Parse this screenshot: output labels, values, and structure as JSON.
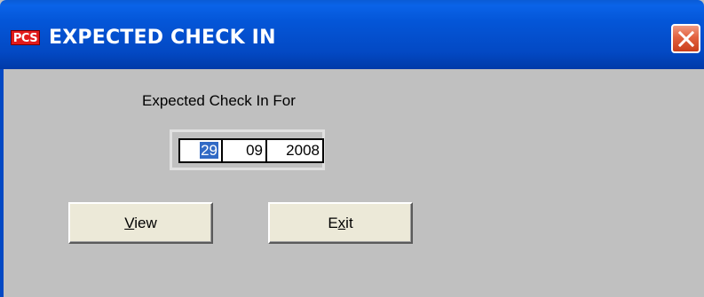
{
  "window": {
    "app_icon_text": "PCS",
    "title": "EXPECTED CHECK IN"
  },
  "form": {
    "label": "Expected Check In For",
    "date": {
      "day": "29",
      "month": "09",
      "year": "2008"
    }
  },
  "buttons": {
    "view": {
      "mnemonic": "V",
      "rest": "iew"
    },
    "exit": {
      "before": "E",
      "mnemonic": "x",
      "after": "it"
    }
  },
  "colors": {
    "titlebar": "#0456d8",
    "close_button": "#e2623f",
    "window_bg": "#c0c0c0",
    "button_face": "#ece9d8",
    "selection": "#316ac5"
  }
}
